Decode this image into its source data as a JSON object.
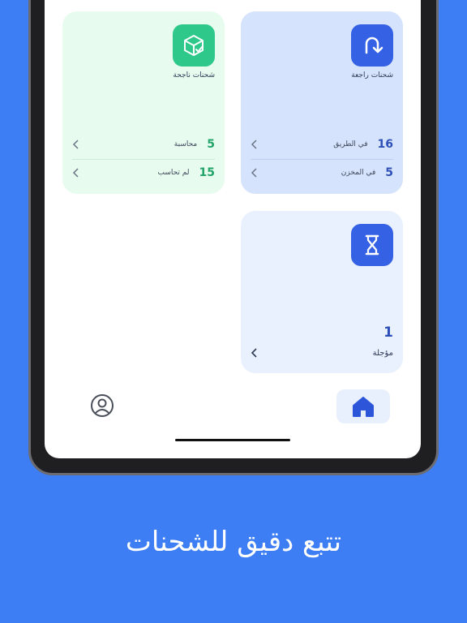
{
  "cards": {
    "successful": {
      "title": "شحنات ناجحة",
      "icon": "box-check-icon",
      "rows": [
        {
          "count": "5",
          "label": "محاسبة"
        },
        {
          "count": "15",
          "label": "لم تحاسب"
        }
      ]
    },
    "returned": {
      "title": "شحنات راجعة",
      "icon": "return-arrow-icon",
      "rows": [
        {
          "count": "16",
          "label": "في الطريق"
        },
        {
          "count": "5",
          "label": "في المخزن"
        }
      ]
    },
    "postponed": {
      "icon": "hourglass-icon",
      "count": "1",
      "label": "مؤجلة"
    }
  },
  "nav": {
    "home_icon": "home-icon",
    "profile_icon": "user-circle-icon"
  },
  "tagline": "تتبع دقيق للشحنات",
  "colors": {
    "background": "#3d7ef5",
    "green_card": "#e7fbef",
    "green_accent": "#2ec98a",
    "blue_card": "#d6e3fc",
    "blue_accent": "#3561e5",
    "light_card": "#eaf1fe"
  }
}
